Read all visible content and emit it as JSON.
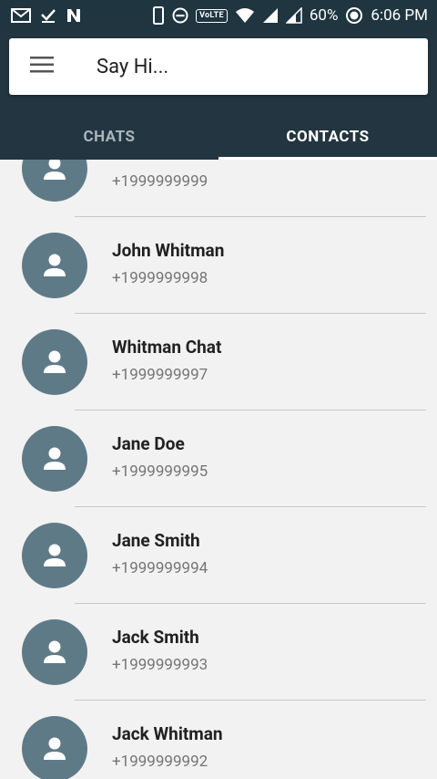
{
  "status_bar": {
    "battery": "60%",
    "time": "6:06 PM",
    "volte": "VoLTE",
    "icons_left": [
      "gmail-icon",
      "download-done-icon",
      "n-app-icon"
    ],
    "icons_right": [
      "vibrate-icon",
      "dnd-icon",
      "volte-icon",
      "wifi-icon",
      "signal-icon",
      "signal-icon-2",
      "battery-icon"
    ]
  },
  "search": {
    "placeholder": "Say Hi..."
  },
  "tabs": [
    {
      "label": "CHATS",
      "active": false
    },
    {
      "label": "CONTACTS",
      "active": true
    }
  ],
  "contacts": [
    {
      "name": "",
      "phone": "+1999999999"
    },
    {
      "name": "John Whitman",
      "phone": "+1999999998"
    },
    {
      "name": "Whitman Chat",
      "phone": "+1999999997"
    },
    {
      "name": "Jane Doe",
      "phone": "+1999999995"
    },
    {
      "name": "Jane Smith",
      "phone": "+1999999994"
    },
    {
      "name": "Jack Smith",
      "phone": "+1999999993"
    },
    {
      "name": "Jack Whitman",
      "phone": "+1999999992"
    }
  ],
  "colors": {
    "header": "#233540",
    "avatar": "#5f7a87",
    "background": "#f2f2f2"
  }
}
